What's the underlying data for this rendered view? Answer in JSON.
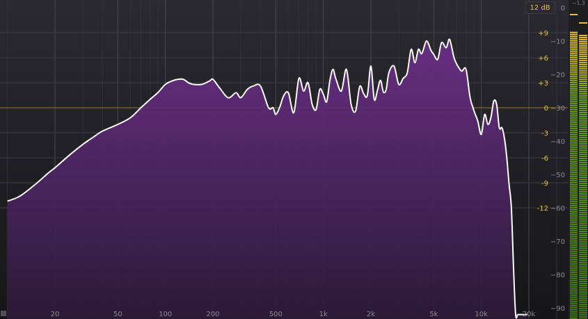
{
  "app": {
    "range_button": "12 dB",
    "meter_peak_readout": "−1.3",
    "meter_level_fraction": 0.93,
    "meter_level_fraction_r": 0.92
  },
  "axes": {
    "freq_labels": [
      {
        "f": 20,
        "label": "20"
      },
      {
        "f": 50,
        "label": "50"
      },
      {
        "f": 100,
        "label": "100"
      },
      {
        "f": 200,
        "label": "200"
      },
      {
        "f": 500,
        "label": "500"
      },
      {
        "f": 1000,
        "label": "1k"
      },
      {
        "f": 2000,
        "label": "2k"
      },
      {
        "f": 5000,
        "label": "5k"
      },
      {
        "f": 10000,
        "label": "10k"
      },
      {
        "f": 20000,
        "label": "20k"
      }
    ],
    "eq_labels": [
      {
        "db": 9,
        "label": "+9"
      },
      {
        "db": 6,
        "label": "+6"
      },
      {
        "db": 3,
        "label": "+3"
      },
      {
        "db": 0,
        "label": "0"
      },
      {
        "db": -3,
        "label": "-3"
      },
      {
        "db": -6,
        "label": "-6"
      },
      {
        "db": -9,
        "label": "-9"
      },
      {
        "db": -12,
        "label": "-12"
      }
    ],
    "spectrum_labels": [
      {
        "db": 0,
        "label": "0"
      },
      {
        "db": -10,
        "label": "−10"
      },
      {
        "db": -20,
        "label": "−20"
      },
      {
        "db": -30,
        "label": "−30"
      },
      {
        "db": -40,
        "label": "−40"
      },
      {
        "db": -50,
        "label": "−50"
      },
      {
        "db": -60,
        "label": "−60"
      },
      {
        "db": -70,
        "label": "−70"
      },
      {
        "db": -80,
        "label": "−80"
      },
      {
        "db": -90,
        "label": "−90"
      }
    ],
    "x_range_hz": [
      10,
      30000
    ]
  },
  "colors": {
    "accent_yellow": "#e8c040",
    "curve": "#ffffff",
    "fill_top": "#6a2f86",
    "fill_bottom": "#2c1a38",
    "meter_green": "#4a8a1e",
    "meter_yellow": "#c8b830"
  },
  "chart_data": {
    "type": "area",
    "x_scale": "log",
    "ylabel": "",
    "xlabel": "",
    "ylim": [
      -92,
      0
    ],
    "series": [
      {
        "x": [
          10,
          12,
          15,
          18,
          20,
          25,
          30,
          35,
          40,
          50,
          60,
          70,
          80,
          90,
          100,
          110,
          120,
          130,
          140,
          150,
          170,
          190,
          200,
          220,
          250,
          280,
          300,
          330,
          360,
          400,
          450,
          480,
          500,
          530,
          560,
          600,
          650,
          700,
          750,
          800,
          850,
          900,
          950,
          1000,
          1050,
          1100,
          1150,
          1200,
          1300,
          1400,
          1500,
          1600,
          1700,
          1800,
          1900,
          2000,
          2100,
          2200,
          2300,
          2400,
          2500,
          2600,
          2800,
          3000,
          3200,
          3400,
          3600,
          3800,
          4000,
          4200,
          4500,
          4800,
          5000,
          5300,
          5600,
          6000,
          6300,
          6700,
          7000,
          7500,
          8000,
          8500,
          9000,
          9500,
          10000,
          10500,
          11000,
          11500,
          12000,
          12500,
          13000,
          13500,
          14000,
          14500,
          15000,
          15500,
          16000,
          16500,
          17000,
          17500,
          18000,
          18500,
          19000,
          19500
        ],
        "y": [
          -58,
          -56.5,
          -53,
          -49.7,
          -48,
          -44,
          -41,
          -38.8,
          -37,
          -35,
          -33,
          -30,
          -27.5,
          -25.4,
          -23,
          -22,
          -21.5,
          -21.5,
          -22.5,
          -23,
          -23,
          -22,
          -21.5,
          -24,
          -27,
          -25.5,
          -27,
          -24.5,
          -23.5,
          -23.5,
          -30,
          -30,
          -32,
          -29.8,
          -26.5,
          -25.5,
          -31.5,
          -21.2,
          -25,
          -22.5,
          -29,
          -30.5,
          -24.5,
          -26,
          -28.2,
          -21.8,
          -18.5,
          -21.3,
          -25,
          -18.5,
          -29,
          -31,
          -23.6,
          -25.8,
          -26.3,
          -17.5,
          -27.5,
          -24.8,
          -21.8,
          -25.3,
          -24.5,
          -19.5,
          -17.5,
          -23,
          -21.2,
          -19.5,
          -12.5,
          -16.5,
          -12.5,
          -13.8,
          -10,
          -12.8,
          -14,
          -15.5,
          -10.5,
          -12,
          -9.5,
          -14.8,
          -17,
          -19,
          -18.5,
          -27,
          -31,
          -34,
          -38,
          -32,
          -35,
          -33,
          -28,
          -29,
          -36,
          -36,
          -39,
          -45,
          -53,
          -60,
          -78,
          -92,
          -92,
          -92,
          -92,
          -92,
          -92,
          -92
        ]
      }
    ]
  }
}
